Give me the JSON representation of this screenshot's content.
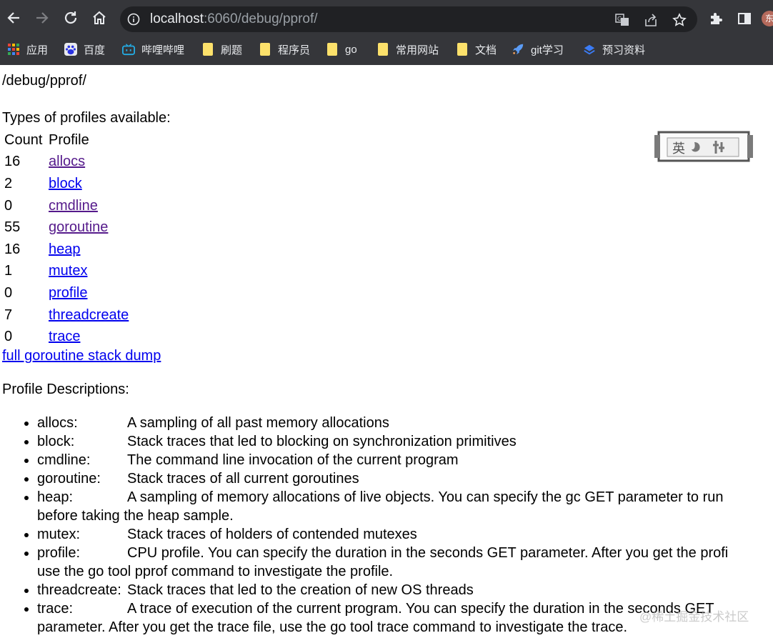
{
  "browser": {
    "url_host": "localhost",
    "url_rest": ":6060/debug/pprof/",
    "avatar_text": "东",
    "icons": [
      "back-icon",
      "forward-icon",
      "reload-icon",
      "home-icon",
      "info-icon",
      "translate-icon",
      "share-icon",
      "bookmark-star-icon",
      "extensions-icon",
      "side-panel-icon"
    ]
  },
  "bookmarks": [
    {
      "label": "应用",
      "icon": "apps-grid-icon"
    },
    {
      "label": "百度",
      "icon": "baidu-icon"
    },
    {
      "label": "哔哩哔哩",
      "icon": "bilibili-icon"
    },
    {
      "label": "刷题",
      "icon": "folder-icon"
    },
    {
      "label": "程序员",
      "icon": "folder-icon"
    },
    {
      "label": "go",
      "icon": "folder-icon"
    },
    {
      "label": "常用网站",
      "icon": "folder-icon"
    },
    {
      "label": "文档",
      "icon": "folder-icon"
    },
    {
      "label": "git学习",
      "icon": "rocket-icon"
    },
    {
      "label": "预习资料",
      "icon": "layers-icon"
    }
  ],
  "page": {
    "path_title": "/debug/pprof/",
    "types_heading": "Types of profiles available:",
    "table_headers": {
      "count": "Count",
      "profile": "Profile"
    },
    "profiles": [
      {
        "count": "16",
        "name": "allocs",
        "visited": true
      },
      {
        "count": "2",
        "name": "block",
        "visited": false
      },
      {
        "count": "0",
        "name": "cmdline",
        "visited": true
      },
      {
        "count": "55",
        "name": "goroutine",
        "visited": true
      },
      {
        "count": "16",
        "name": "heap",
        "visited": false
      },
      {
        "count": "1",
        "name": "mutex",
        "visited": false
      },
      {
        "count": "0",
        "name": "profile",
        "visited": false
      },
      {
        "count": "7",
        "name": "threadcreate",
        "visited": false
      },
      {
        "count": "0",
        "name": "trace",
        "visited": false
      }
    ],
    "full_dump_link": "full goroutine stack dump",
    "descriptions_heading": "Profile Descriptions:",
    "descriptions": [
      {
        "name": "allocs:",
        "line1": "A sampling of all past memory allocations",
        "line2": ""
      },
      {
        "name": "block:",
        "line1": "Stack traces that led to blocking on synchronization primitives",
        "line2": ""
      },
      {
        "name": "cmdline:",
        "line1": "The command line invocation of the current program",
        "line2": ""
      },
      {
        "name": "goroutine:",
        "line1": "Stack traces of all current goroutines",
        "line2": ""
      },
      {
        "name": "heap:",
        "line1": "A sampling of memory allocations of live objects. You can specify the gc GET parameter to run",
        "line2": "before taking the heap sample."
      },
      {
        "name": "mutex:",
        "line1": "Stack traces of holders of contended mutexes",
        "line2": ""
      },
      {
        "name": "profile:",
        "line1": "CPU profile. You can specify the duration in the seconds GET parameter. After you get the profi",
        "line2": "use the go tool pprof command to investigate the profile."
      },
      {
        "name": "threadcreate:",
        "line1": "Stack traces that led to the creation of new OS threads",
        "line2": ""
      },
      {
        "name": "trace:",
        "line1": "A trace of execution of the current program. You can specify the duration in the seconds GET",
        "line2": "parameter. After you get the trace file, use the go tool trace command to investigate the trace."
      }
    ]
  },
  "overlay": {
    "ime_text": "英",
    "watermark": "@稀土掘金技术社区"
  },
  "colors": {
    "chrome_bg": "#35363a",
    "omnibox_bg": "#202124",
    "link": "#0000ee",
    "link_visited": "#551a8b",
    "folder": "#fce16b"
  }
}
